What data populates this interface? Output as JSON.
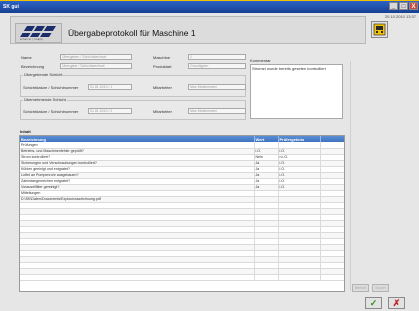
{
  "window": {
    "title": "SK gui",
    "minimize": "_",
    "maximize": "□",
    "close": "X",
    "datetime": "20.10.2010 13:37"
  },
  "header": {
    "logo_sub": "scherrer | knapp",
    "title": "Übergabeprotokoll für Maschine 1"
  },
  "form": {
    "name_label": "Name",
    "name_value": "Übergaben / Schichtwechsel",
    "maschine_label": "Maschine",
    "maschine_value": "1",
    "bezeichnung_label": "Bezeichnung",
    "bezeichnung_value": "Übergabe / Schichtwechsel",
    "produktart_label": "Produktart",
    "produktart_value": "Grundtypen",
    "uebergebende_label": "Übergebende Schicht",
    "schichtdatum_label1": "Schichtdatum / Schichtnummer",
    "schichtdatum_value1": "01.01.2010 / 1",
    "mitarbeiter_label1": "Mitarbeiter",
    "mitarbeiter_value1": "Max Mustermann",
    "uebernehmende_label": "Übernehmende Schicht",
    "schichtdatum_label2": "Schichtdatum / Schichtnummer",
    "schichtdatum_value2": "01.01.2010 / 2",
    "mitarbeiter_label2": "Mitarbeiter",
    "mitarbeiter_value2": "Max Mustermann",
    "kommentar_label": "Kommentar",
    "kommentar_value": "Stromzt wurde bereits geseten kontrolliert"
  },
  "table": {
    "section_label": "Inhalt",
    "columns": [
      "Bezeichnung",
      "Wert",
      "Prüfergebnis",
      ""
    ],
    "rows": [
      [
        "Prüfungen",
        "",
        "",
        ""
      ],
      [
        "Betriebs- und Maschinenfehler geprüft?",
        "i.O.",
        "i.O.",
        ""
      ],
      [
        "Strom kontrolliert?",
        "Nein",
        "n.i.O.",
        ""
      ],
      [
        "Sicherungen und Verschraubungen kontrolliert?",
        "Ja",
        "i.O.",
        ""
      ],
      [
        "Kühlen geeinigt und entgratet?",
        "Ja",
        "i.O.",
        ""
      ],
      [
        "Luftet an Pumpenrohr ausgebauen?",
        "Ja",
        "i.O.",
        ""
      ],
      [
        "Zahnstangenrechen entgratet?",
        "Ja",
        "i.O.",
        ""
      ],
      [
        "Vorauseilfilter gereinigt?",
        "Ja",
        "i.O.",
        ""
      ],
      [
        "Mitteilungen",
        "",
        "",
        ""
      ],
      [
        "D:\\SK\\Daten\\Documents\\Explosionszeichnung.pdf",
        "",
        "",
        ""
      ],
      [
        "",
        "",
        "",
        ""
      ],
      [
        "",
        "",
        "",
        ""
      ],
      [
        "",
        "",
        "",
        ""
      ],
      [
        "",
        "",
        "",
        ""
      ],
      [
        "",
        "",
        "",
        ""
      ],
      [
        "",
        "",
        "",
        ""
      ],
      [
        "",
        "",
        "",
        ""
      ],
      [
        "",
        "",
        "",
        ""
      ],
      [
        "",
        "",
        "",
        ""
      ],
      [
        "",
        "",
        "",
        ""
      ],
      [
        "",
        "",
        "",
        ""
      ],
      [
        "",
        "",
        "",
        ""
      ],
      [
        "",
        "",
        "",
        ""
      ]
    ]
  },
  "sidebar": {
    "btn1": "Bericht",
    "btn2": "Export"
  },
  "actions": {
    "ok": "✓",
    "cancel": "✗"
  },
  "colors": {
    "accent": "#f2c200",
    "header_blue": "#3f73bf",
    "ok_green": "#3c8a1f",
    "cancel_red": "#c0251c"
  }
}
